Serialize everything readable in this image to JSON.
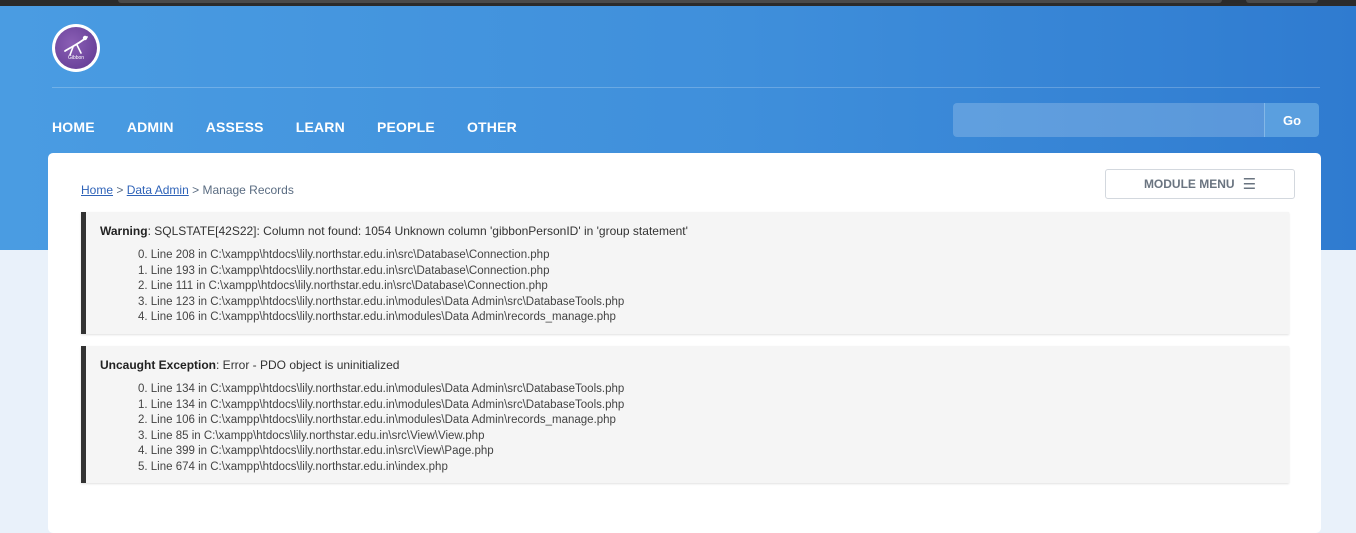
{
  "logo": {
    "text": "Gibbon"
  },
  "nav": {
    "items": [
      "HOME",
      "ADMIN",
      "ASSESS",
      "LEARN",
      "PEOPLE",
      "OTHER"
    ]
  },
  "search": {
    "value": "",
    "go_label": "Go"
  },
  "breadcrumb": {
    "home": "Home",
    "sep": ">",
    "data_admin": "Data Admin",
    "current": "Manage Records"
  },
  "module_menu": {
    "label": "MODULE MENU",
    "icon": "hamburger-icon"
  },
  "warning": {
    "label": "Warning",
    "message": ": SQLSTATE[42S22]: Column not found: 1054 Unknown column 'gibbonPersonID' in 'group statement'",
    "trace": [
      "0. Line 208 in C:\\xampp\\htdocs\\lily.northstar.edu.in\\src\\Database\\Connection.php",
      "1. Line 193 in C:\\xampp\\htdocs\\lily.northstar.edu.in\\src\\Database\\Connection.php",
      "2. Line 111 in C:\\xampp\\htdocs\\lily.northstar.edu.in\\src\\Database\\Connection.php",
      "3. Line 123 in C:\\xampp\\htdocs\\lily.northstar.edu.in\\modules\\Data Admin\\src\\DatabaseTools.php",
      "4. Line 106 in C:\\xampp\\htdocs\\lily.northstar.edu.in\\modules\\Data Admin\\records_manage.php"
    ]
  },
  "exception": {
    "label": "Uncaught Exception",
    "message": ": Error - PDO object is uninitialized",
    "trace": [
      "0. Line 134 in C:\\xampp\\htdocs\\lily.northstar.edu.in\\modules\\Data Admin\\src\\DatabaseTools.php",
      "1. Line 134 in C:\\xampp\\htdocs\\lily.northstar.edu.in\\modules\\Data Admin\\src\\DatabaseTools.php",
      "2. Line 106 in C:\\xampp\\htdocs\\lily.northstar.edu.in\\modules\\Data Admin\\records_manage.php",
      "3. Line 85 in C:\\xampp\\htdocs\\lily.northstar.edu.in\\src\\View\\View.php",
      "4. Line 399 in C:\\xampp\\htdocs\\lily.northstar.edu.in\\src\\View\\Page.php",
      "5. Line 674 in C:\\xampp\\htdocs\\lily.northstar.edu.in\\index.php"
    ]
  },
  "colors": {
    "header_start": "#4a9ce2",
    "header_end": "#2f7bd0",
    "error_border": "#333333",
    "link": "#2f63b8"
  }
}
